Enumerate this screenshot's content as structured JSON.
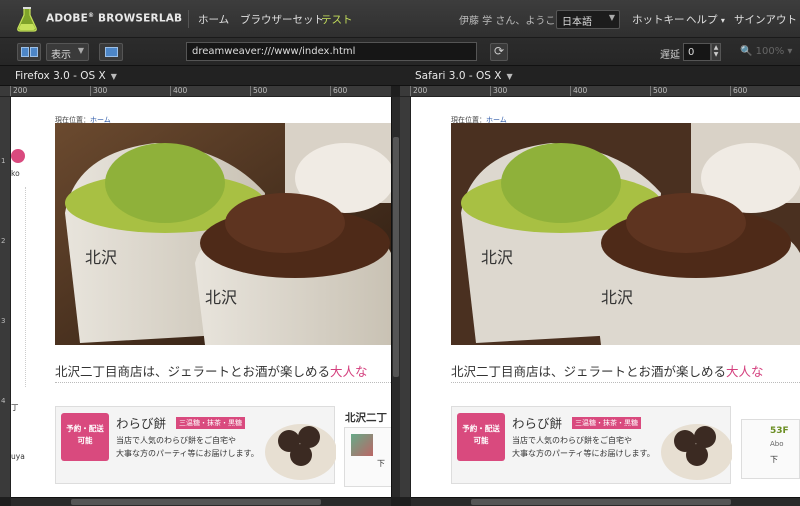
{
  "header": {
    "brand": "ADOBE",
    "brand_mark": "®",
    "brand_name": "BROWSERLAB",
    "nav": [
      {
        "label": "ホーム"
      },
      {
        "label": "ブラウザーセット"
      },
      {
        "label": "テスト"
      }
    ],
    "user_greeting": "伊藤 学 さん、ようこそ",
    "language": "日本語",
    "right_nav": [
      {
        "label": "ホットキー"
      },
      {
        "label": "ヘルプ"
      },
      {
        "label": "サインアウト"
      }
    ]
  },
  "toolbar": {
    "view_label": "表示",
    "url": "dreamweaver:///www/index.html",
    "delay_label": "遅延",
    "delay_value": "0",
    "zoom": "100%"
  },
  "panes": [
    {
      "browser": "Firefox 3.0 - OS X",
      "ruler_ticks": [
        "200",
        "300",
        "400",
        "500",
        "600"
      ]
    },
    {
      "browser": "Safari 3.0 - OS X",
      "ruler_ticks": [
        "200",
        "300",
        "400",
        "500",
        "600"
      ]
    }
  ],
  "vertical_ruler_ticks": [
    "1",
    "2",
    "3",
    "4"
  ],
  "page": {
    "breadcrumb_prefix": "現在位置：",
    "breadcrumb_home": "ホーム",
    "headline_main": "北沢二丁目商店は、ジェラートとお酒が楽しめる",
    "headline_pink": "大人な",
    "banner": {
      "badge_line1": "予約・配送",
      "badge_line2": "可能",
      "title": "わらび餅",
      "tag": "三温糖・抹茶・黒糖",
      "desc_line1": "当店で人気のわらび餅をご自宅や",
      "desc_line2": "大事な方のパーティ等にお届けします。"
    },
    "side_title": "北沢二丁",
    "side_num": "53F",
    "side_sub": "Abo",
    "side_ja": "下",
    "left_col_text_1": "ko",
    "left_col_text_2": "丁",
    "left_col_text_3": "uya"
  },
  "colors": {
    "accent_green": "#c7e25c",
    "pink": "#d94a7e"
  }
}
